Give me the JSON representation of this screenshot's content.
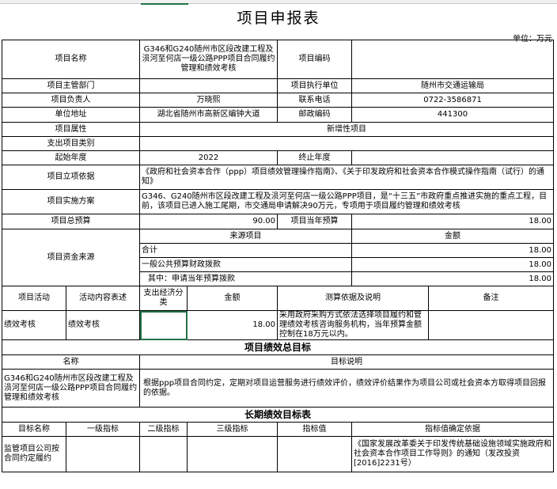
{
  "title": "项目申报表",
  "unit": "单位：万元",
  "labels": {
    "project_name": "项目名称",
    "project_code": "项目编码",
    "dept": "项目主管部门",
    "exec_unit": "项目执行单位",
    "owner": "项目负责人",
    "phone": "联系电话",
    "address": "单位地址",
    "postcode": "邮政编码",
    "attribute": "项目属性",
    "category": "支出项目类别",
    "start_year": "起始年度",
    "end_year": "终止年度",
    "basis": "项目立项依据",
    "plan": "项目实施方案",
    "total_budget": "项目总预算",
    "current_budget": "项目当年预算",
    "funding": "项目资金来源",
    "source_header": "来源项目",
    "amount_header": "金额"
  },
  "values": {
    "project_name": "G346和G240随州市区段改建工程及涢河至何店一级公路PPP项目合同履约管理和绩效考核",
    "project_code": "",
    "dept": "",
    "exec_unit": "随州市交通运输局",
    "owner": "万晓熙",
    "phone": "0722-3586871",
    "address": "湖北省随州市高新区编钟大道",
    "postcode": "441300",
    "attribute": "新增性项目",
    "category": "",
    "start_year": "2022",
    "end_year": "",
    "basis": "《政府和社会资本合作（ppp）项目绩效管理操作指南》、《关于印发政府和社会资本合作模式操作指南（试行）的通知》",
    "plan": "G346、G240随州市区段改建工程及涢河至何店一级公路PPP项目，是“十三五”市政府重点推进实施的重点工程，目前，该项目已进入施工尾期，市交通局申请解决90万元，专项用于项目履约管理和绩效考核",
    "total_budget": "90.00",
    "current_budget": "18.00"
  },
  "funding_rows": [
    {
      "name": "合计",
      "amount": "18.00"
    },
    {
      "name": "一般公共预算财政拨款",
      "amount": "18.00"
    },
    {
      "name": "其中：申请当年预算拨款",
      "amount": "18.00"
    }
  ],
  "activity_headers": {
    "activity": "项目活动",
    "content": "活动内容表述",
    "econ": "支出经济分类",
    "amount": "金额",
    "basis": "测算依据及说明",
    "remark": "备注"
  },
  "activity_rows": [
    {
      "activity": "绩效考核",
      "content": "绩效考核",
      "econ": "",
      "amount": "18.00",
      "basis": "采用政府采购方式依法选择项目履约和管理绩效考核咨询服务机构，当年预算金额控制在18万元以内。",
      "remark": ""
    }
  ],
  "overall_goal": {
    "section_title": "项目绩效总目标",
    "name_header": "名称",
    "desc_header": "目标说明",
    "name": "G346和G240随州市区段改建工程及涢河至何店一级公路PPP项目合同履约管理和绩效考核",
    "desc": "根据ppp项目合同约定，定期对项目运营服务进行绩效评价，绩效评价结果作为项目公司或社会资本方取得项目回报的依据。"
  },
  "longterm": {
    "section_title": "长期绩效目标表",
    "headers": {
      "target": "目标名称",
      "l1": "一级指标",
      "l2": "二级指标",
      "l3": "三级指标",
      "value": "指标值",
      "basis": "指标值确定依据"
    },
    "rows": [
      {
        "target": "监管项目公司按合同约定履约",
        "l1": "",
        "l2": "",
        "l3": "",
        "value": "",
        "basis": "《国家发展改革委关于印发传统基础设施领域实施政府和社会资本合作项目工作导则》的通知（发改投资[2016]2231号）"
      }
    ]
  }
}
